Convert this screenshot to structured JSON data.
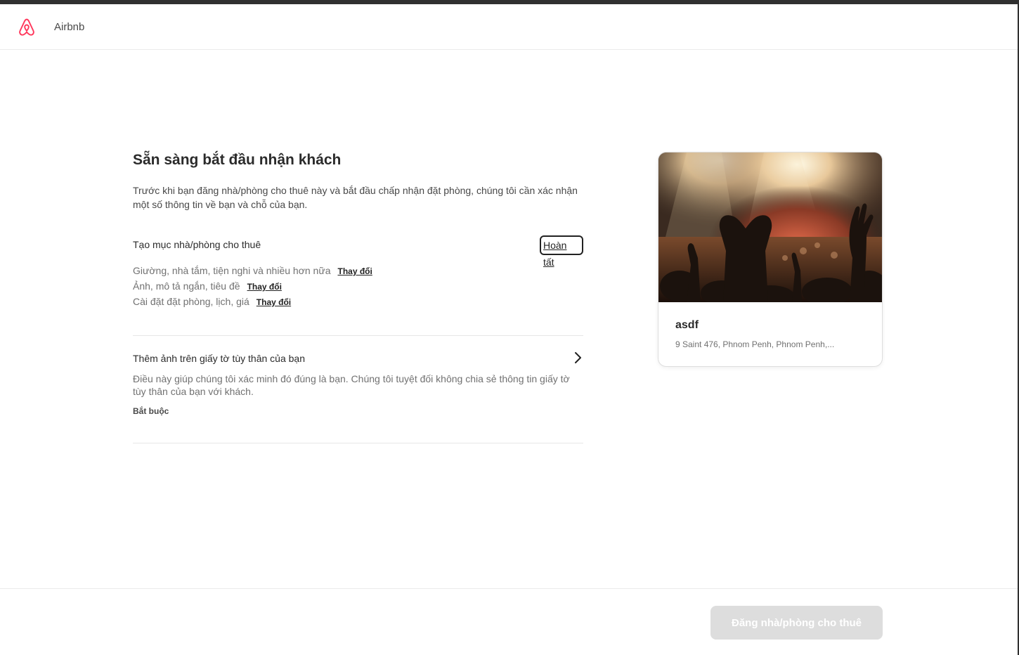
{
  "header": {
    "logo_icon": "airbnb-logo-icon",
    "brand": "Airbnb"
  },
  "main": {
    "title": "Sẵn sàng bắt đầu nhận khách",
    "subtitle": "Trước khi bạn đăng nhà/phòng cho thuê này và bắt đầu chấp nhận đặt phòng, chúng tôi cần xác nhận một số thông tin về bạn và chỗ của bạn.",
    "create_listing": {
      "label": "Tạo mục nhà/phòng cho thuê",
      "status_button": "Hoàn tất",
      "details": [
        {
          "text": "Giường, nhà tắm, tiện nghi và nhiều hơn nữa",
          "action": "Thay đổi"
        },
        {
          "text": "Ảnh, mô tả ngắn, tiêu đề",
          "action": "Thay đổi"
        },
        {
          "text": "Cài đặt đặt phòng, lịch, giá",
          "action": "Thay đổi"
        }
      ]
    },
    "id_photo": {
      "label": "Thêm ảnh trên giấy tờ tùy thân của bạn",
      "description": "Điều này giúp chúng tôi xác minh đó đúng là bạn. Chúng tôi tuyệt đối không chia sẻ thông tin giấy tờ tùy thân của bạn với khách.",
      "required": "Bắt buộc",
      "icon": "chevron-right-icon"
    }
  },
  "listing_card": {
    "title": "asdf",
    "address": "9 Saint 476, Phnom Penh, Phnom Penh,..."
  },
  "footer": {
    "publish_button": "Đăng nhà/phòng cho thuê"
  },
  "colors": {
    "brand": "#FF385C",
    "button_disabled": "#DDDDDD",
    "text_primary": "#222222",
    "text_secondary": "#717171"
  }
}
